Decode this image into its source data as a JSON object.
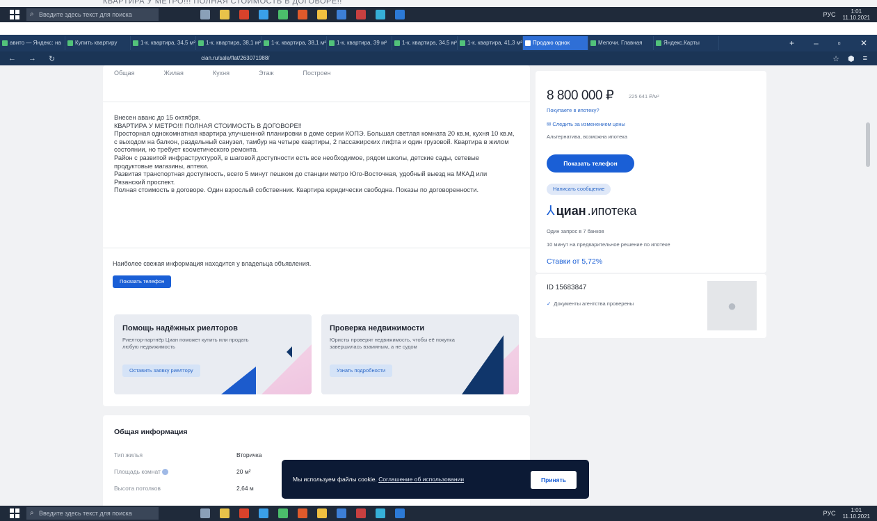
{
  "ghost": {
    "text": "КВАРТИРА У МЕТРО!!! ПОЛНАЯ СТОИМОСТЬ В ДОГОВОРЕ!!"
  },
  "taskbar": {
    "search_placeholder": "Введите здесь текст для поиска",
    "tray_lang": "РУС",
    "time": "1:01",
    "date": "11.10.2021"
  },
  "browser": {
    "tabs": [
      {
        "label": "авито — Яндекс: на"
      },
      {
        "label": "Купить квартиру"
      },
      {
        "label": "1-к. квартира, 34,5 м²"
      },
      {
        "label": "1-к. квартира, 38,1 м²"
      },
      {
        "label": "1-к. квартира, 38,1 м²"
      },
      {
        "label": "1-к. квартира, 39 м²"
      },
      {
        "label": "1-к. квартира, 34,5 м²"
      },
      {
        "label": "1-к. квартира, 41,3 м²"
      },
      {
        "label": "Продаю однок"
      },
      {
        "label": "Мелочи. Главная"
      },
      {
        "label": "Яндекс.Карты"
      }
    ],
    "url": "cian.ru/sale/flat/263071988/"
  },
  "listing": {
    "room_tabs": [
      "Общая",
      "Жилая",
      "Кухня",
      "Этаж",
      "Построен"
    ],
    "description": [
      "Внесен аванс до 15 октября.",
      "КВАРТИРА У МЕТРО!!! ПОЛНАЯ СТОИМОСТЬ В ДОГОВОРЕ!!",
      "Просторная однокомнатная квартира улучшенной планировки в доме серии КОПЭ. Большая светлая комната 20 кв.м, кухня 10 кв.м, с выходом на балкон, раздельный санузел, тамбур на четыре квартиры, 2 пассажирских лифта и один грузовой. Квартира в жилом состоянии, но требует косметического ремонта.",
      "Район с развитой инфраструктурой, в шаговой доступности есть все необходимое, рядом школы, детские сады, сетевые продуктовые магазины, аптеки.",
      "Развитая транспортная доступность, всего 5 минут пешком до станции метро Юго-Восточная, удобный выезд на МКАД или Рязанский проспект.",
      "Полная стоимость в договоре. Один взрослый собственник. Квартира юридически свободна. Показы по договоренности."
    ],
    "owner_note": "Наиболее свежая информация находится у владельца объявления.",
    "show_phone_small": "Показать телефон",
    "promo_left": {
      "title": "Помощь надёжных риелторов",
      "desc": "Риелтор-партнёр Циан поможет купить или продать любую недвижимость",
      "button": "Оставить заявку риелтору"
    },
    "promo_right": {
      "title": "Проверка недвижимости",
      "desc": "Юристы проверят недвижимость, чтобы её покупка завершилась взаимным, а не судом",
      "button": "Узнать подробности"
    },
    "general": {
      "title": "Общая информация",
      "rows": [
        {
          "label": "Тип жилья",
          "value": "Вторичка"
        },
        {
          "label": "Площадь комнат",
          "value": "20 м²"
        },
        {
          "label": "Высота потолков",
          "value": "2,64 м"
        }
      ]
    }
  },
  "sidebar": {
    "price": "8 800 000 ₽",
    "price_per_m2": "225 641 ₽/м²",
    "mortgage_link": "Покупаете в ипотеку?",
    "track_price": "Следить за изменением цены",
    "alt_mortgage": "Альтернатива, возможна ипотека",
    "phone_button": "Показать телефон",
    "message_button": "Написать сообщение",
    "logo_word": "циан",
    "logo_suffix": ".ипотека",
    "one_request": "Один запрос в 7 банков",
    "ten_minutes": "10 минут на предварительное решение по ипотеке",
    "rate": "Ставки от 5,72%",
    "agent_id": "ID 15683847",
    "docs_checked": "Документы агентства проверены"
  },
  "cookie": {
    "text": "Мы используем файлы cookie.",
    "link": "Соглашение об использовании",
    "accept": "Принять"
  },
  "colors": {
    "brand_blue": "#1a5fd6",
    "taskbar": "#1f2a3a",
    "tabbar": "#1e3a5f",
    "cookie_bg": "#0c1a35"
  }
}
